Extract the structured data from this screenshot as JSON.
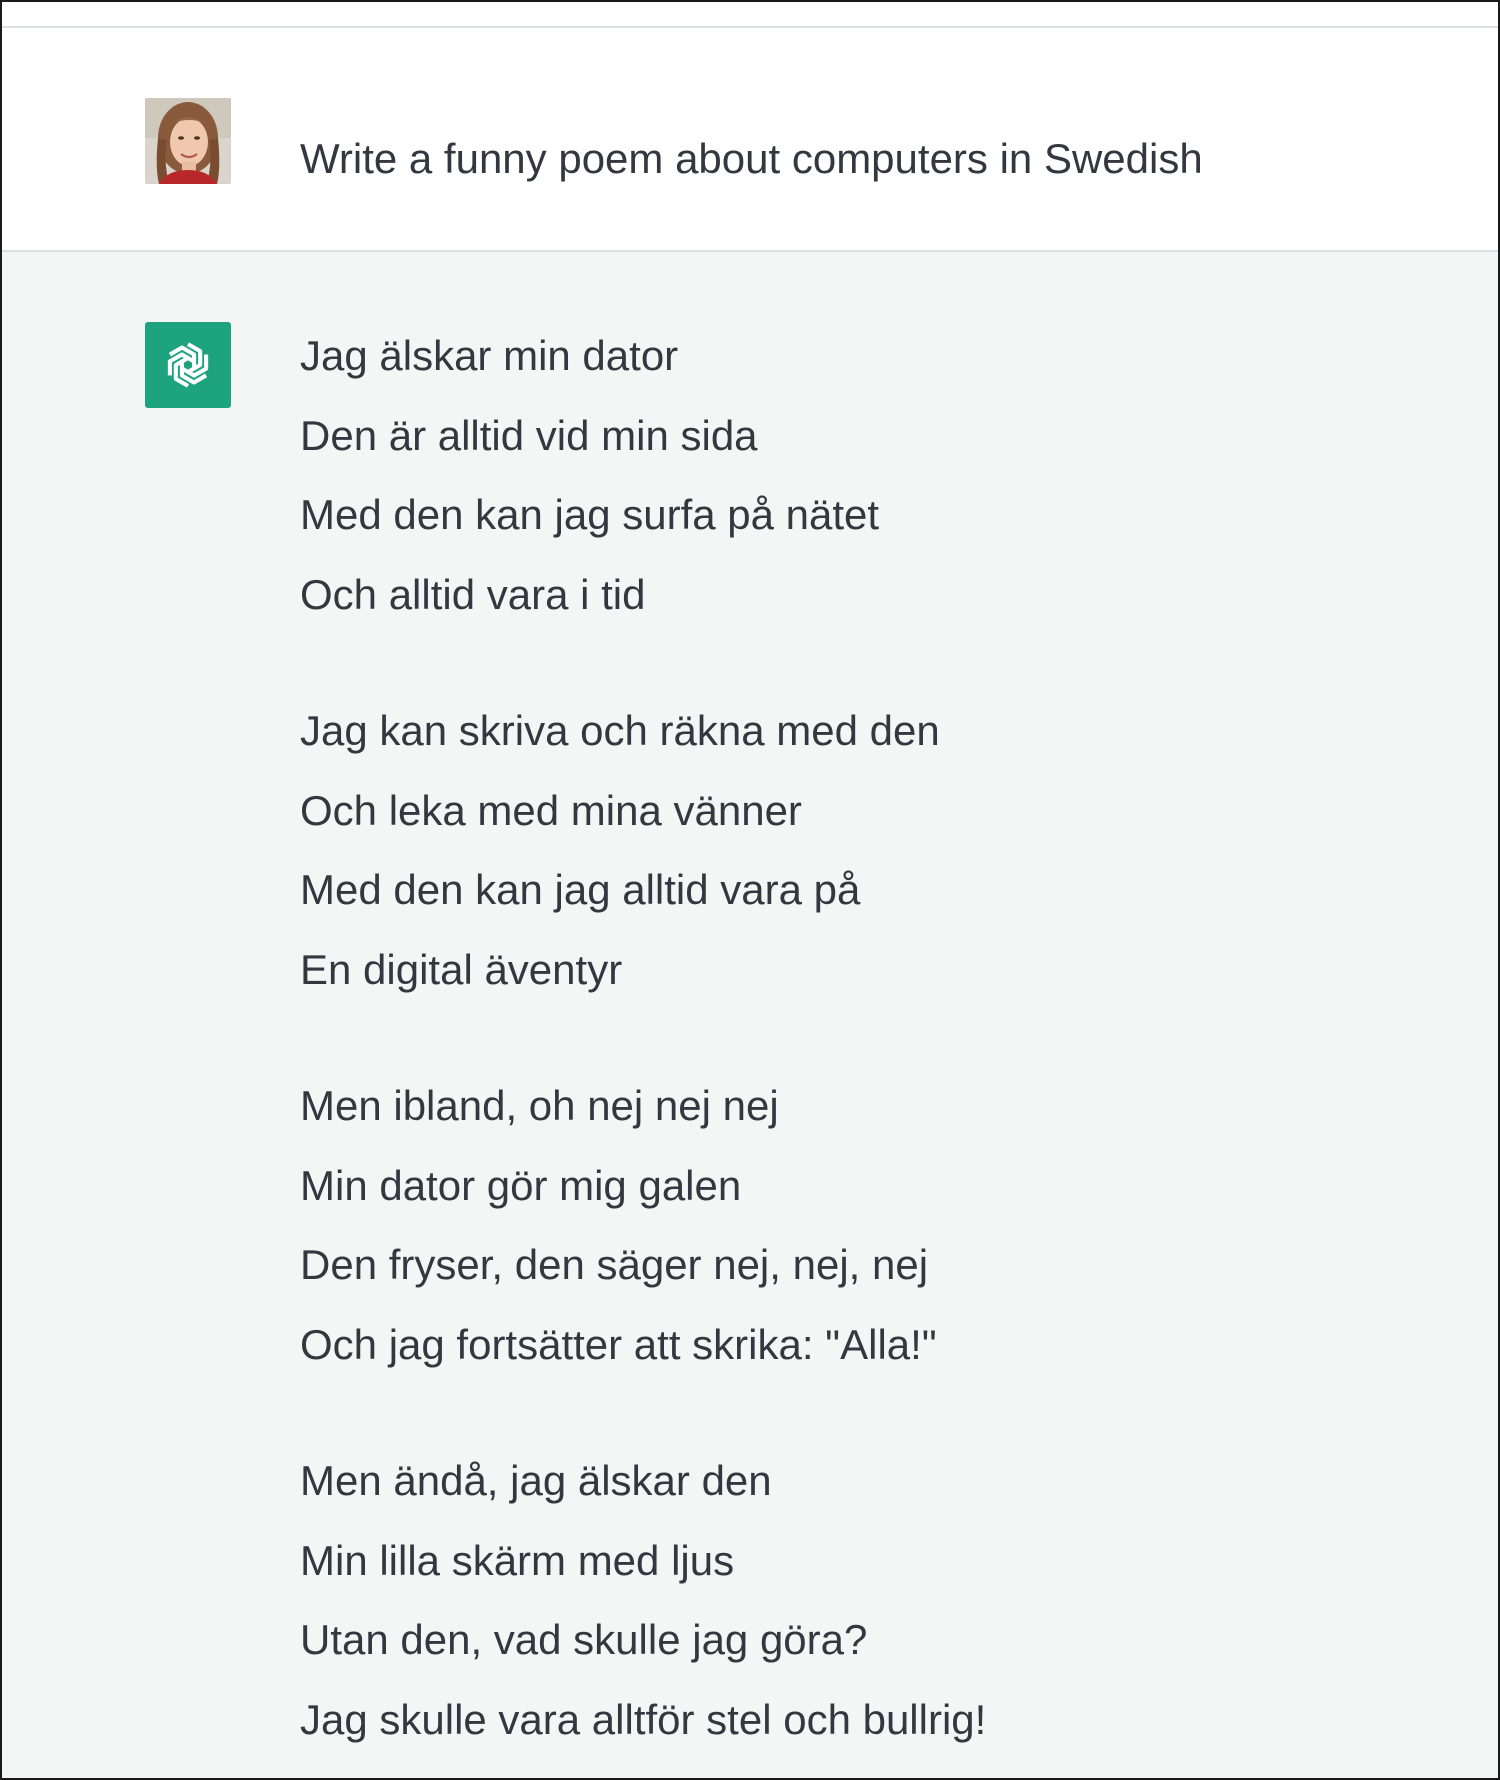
{
  "conversation": {
    "user_message": {
      "avatar_icon": "user-avatar-photo",
      "text": "Write a funny poem about computers in Swedish"
    },
    "assistant_message": {
      "avatar_icon": "openai-logo-icon",
      "avatar_color": "#1ea37f",
      "stanzas": [
        {
          "lines": [
            "Jag älskar min dator",
            "Den är alltid vid min sida",
            "Med den kan jag surfa på nätet",
            "Och alltid vara i tid"
          ]
        },
        {
          "lines": [
            "Jag kan skriva och räkna med den",
            "Och leka med mina vänner",
            "Med den kan jag alltid vara på",
            "En digital äventyr"
          ]
        },
        {
          "lines": [
            "Men ibland, oh nej nej nej",
            "Min dator gör mig galen",
            "Den fryser, den säger nej, nej, nej",
            "Och jag fortsätter att skrika: \"Alla!\""
          ]
        },
        {
          "lines": [
            "Men ändå, jag älskar den",
            "Min lilla skärm med ljus",
            "Utan den, vad skulle jag göra?",
            "Jag skulle vara alltför stel och bullrig!"
          ]
        }
      ]
    }
  },
  "colors": {
    "text": "#353740",
    "user_row_bg": "#ffffff",
    "assistant_row_bg": "#f4f6f6",
    "divider": "#dcdfe3"
  }
}
